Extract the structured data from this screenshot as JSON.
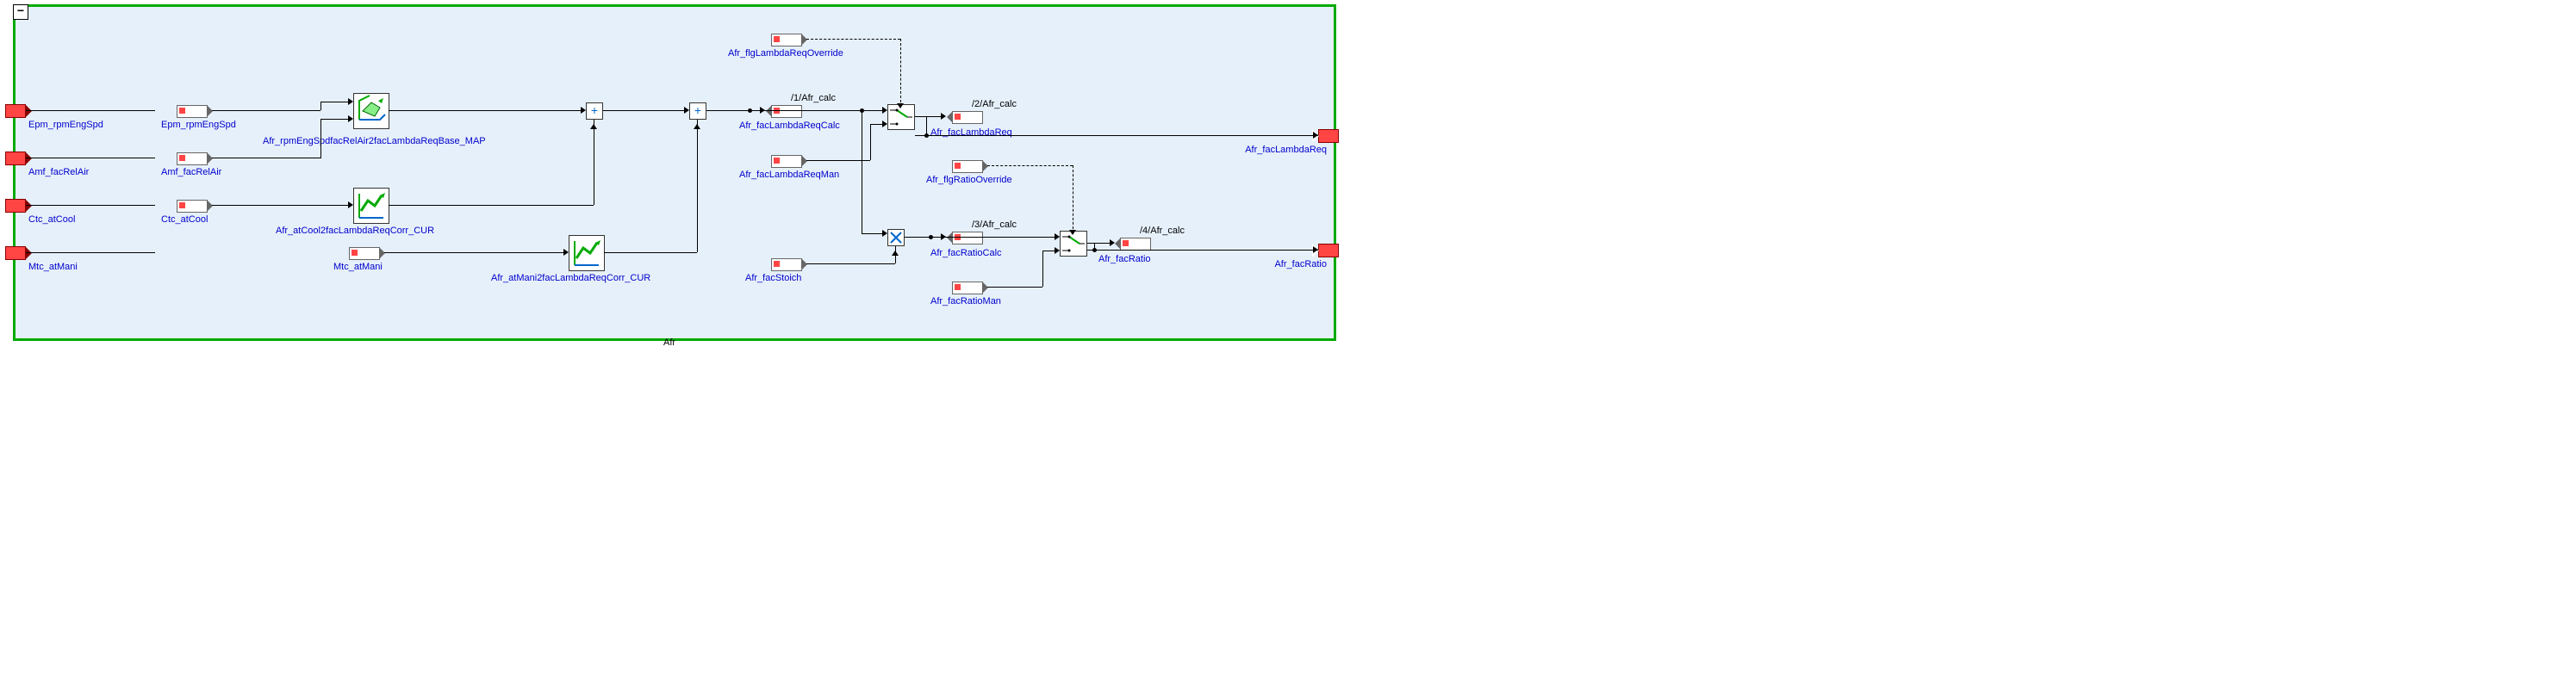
{
  "system_name": "Afr",
  "inports": [
    {
      "name": "Epm_rpmEngSpd"
    },
    {
      "name": "Amf_facRelAir"
    },
    {
      "name": "Ctc_atCool"
    },
    {
      "name": "Mtc_atMani"
    }
  ],
  "outports": [
    {
      "name": "Afr_facLambdaReq"
    },
    {
      "name": "Afr_facRatio"
    }
  ],
  "signal_tags": {
    "in": [
      {
        "name": "Epm_rpmEngSpd"
      },
      {
        "name": "Amf_facRelAir"
      },
      {
        "name": "Ctc_atCool"
      },
      {
        "name": "Mtc_atMani"
      }
    ],
    "consts": [
      {
        "name": "Afr_flgLambdaReqOverride"
      },
      {
        "name": "Afr_facLambdaReqMan"
      },
      {
        "name": "Afr_facStoich"
      },
      {
        "name": "Afr_flgRatioOverride"
      },
      {
        "name": "Afr_facRatioMan"
      }
    ],
    "calc_out": [
      {
        "name": "Afr_facLambdaReqCalc",
        "path": "/1/Afr_calc"
      },
      {
        "name": "Afr_facLambdaReq",
        "path": "/2/Afr_calc"
      },
      {
        "name": "Afr_facRatioCalc",
        "path": "/3/Afr_calc"
      },
      {
        "name": "Afr_facRatio",
        "path": "/4/Afr_calc"
      }
    ]
  },
  "lookup_blocks": [
    {
      "name": "Afr_rpmEngSpdfacRelAir2facLambdaReqBase_MAP",
      "type": "2D_MAP"
    },
    {
      "name": "Afr_atCool2facLambdaReqCorr_CUR",
      "type": "1D_CUR"
    },
    {
      "name": "Afr_atMani2facLambdaReqCorr_CUR",
      "type": "1D_CUR"
    }
  ],
  "operators": [
    {
      "type": "sum",
      "inputs": [
        "map",
        "cool_corr"
      ]
    },
    {
      "type": "sum",
      "inputs": [
        "sum1",
        "mani_corr"
      ]
    },
    {
      "type": "multiply",
      "inputs": [
        "lambdaReq",
        "stoich"
      ]
    }
  ],
  "switches": [
    {
      "name": "lambdaReq_switch",
      "control": "Afr_flgLambdaReqOverride",
      "true_in": "Afr_facLambdaReqMan",
      "false_in": "Afr_facLambdaReqCalc",
      "out": "Afr_facLambdaReq"
    },
    {
      "name": "ratio_switch",
      "control": "Afr_flgRatioOverride",
      "true_in": "Afr_facRatioMan",
      "false_in": "Afr_facRatioCalc",
      "out": "Afr_facRatio"
    }
  ]
}
